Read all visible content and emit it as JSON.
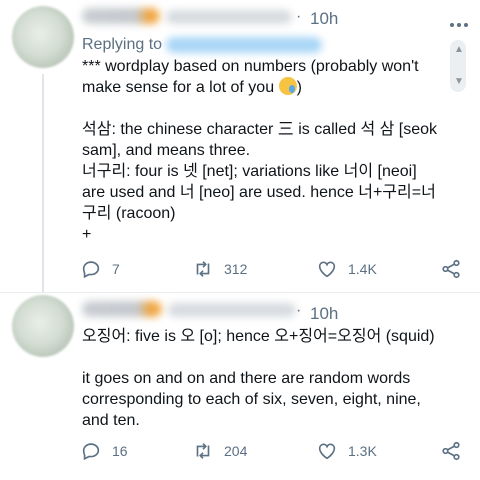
{
  "tweets": [
    {
      "time": "10h",
      "replying_label": "Replying to",
      "lines": [
        "*** wordplay based on numbers (probably won't make sense for a lot of you",
        "",
        "석삼: the chinese character 三 is called 석 삼 [seok sam], and means three.",
        "너구리: four is 넷 [net]; variations like 너이 [neoi] are used and 너 [neo] are used. hence 너+구리=너구리 (racoon)",
        "+"
      ],
      "emoji": "crying-smile-emoji",
      "reply_count": "7",
      "retweet_count": "312",
      "like_count": "1.4K"
    },
    {
      "time": "10h",
      "lines": [
        "오징어: five is 오 [o]; hence 오+징어=오징어 (squid)",
        "",
        "it goes on and on and there are random words corresponding to each of six, seven, eight, nine, and ten."
      ],
      "reply_count": "16",
      "retweet_count": "204",
      "like_count": "1.3K"
    }
  ],
  "icons": {
    "reply": "reply-icon",
    "retweet": "retweet-icon",
    "like": "heart-icon",
    "share": "share-icon",
    "more": "more-icon"
  },
  "colors": {
    "text": "#0f1419",
    "muted": "#5b7083",
    "blurred_link": "#a9d6f7"
  }
}
